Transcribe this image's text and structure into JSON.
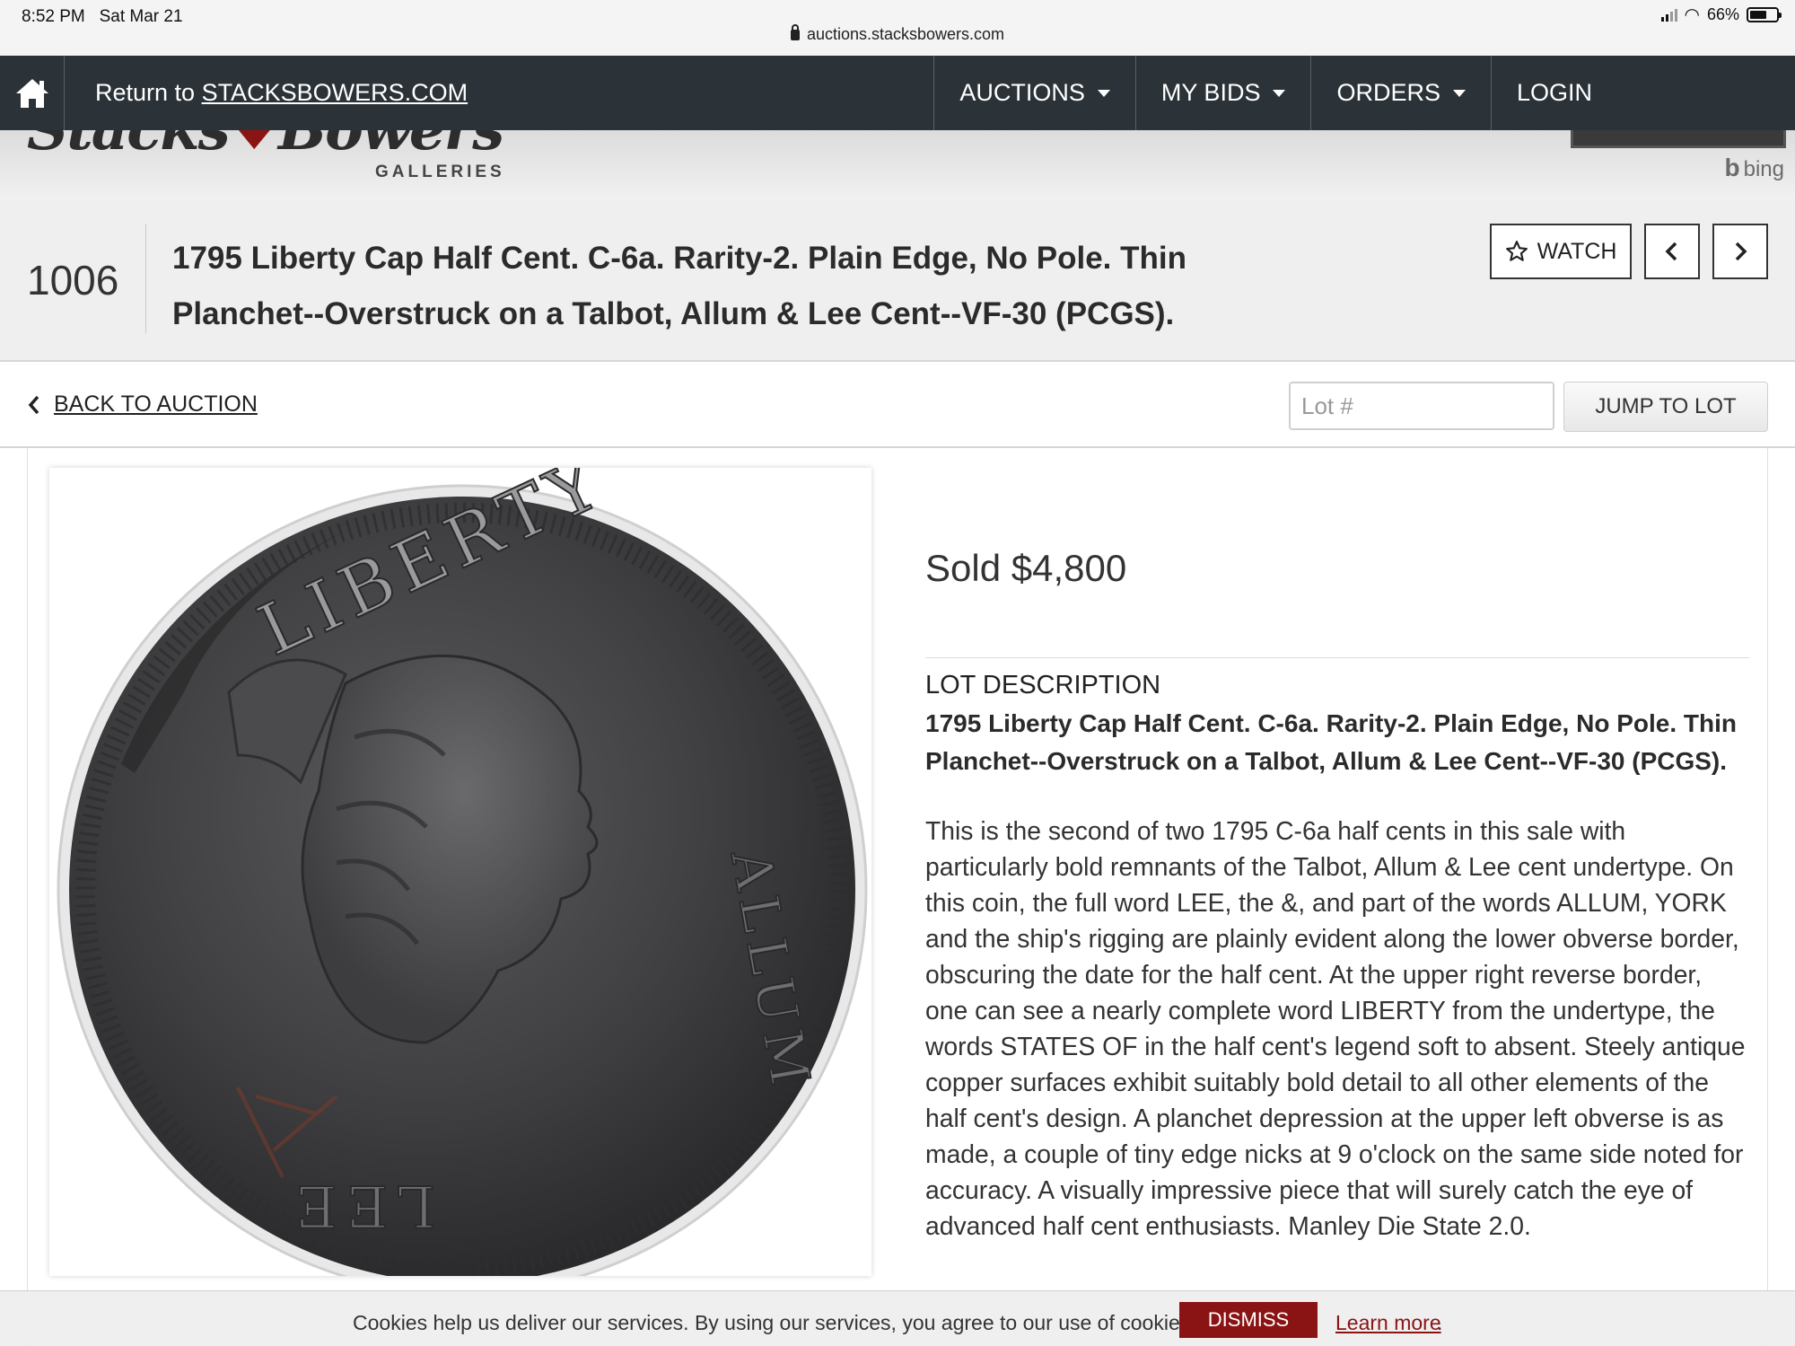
{
  "status_bar": {
    "time": "8:52 PM",
    "date": "Sat Mar 21",
    "url": "auctions.stacksbowers.com",
    "battery": "66%",
    "battery_level": 0.66
  },
  "topnav": {
    "return_prefix": "Return to ",
    "return_link": "STACKSBOWERS.COM",
    "items": [
      {
        "label": "AUCTIONS"
      },
      {
        "label": "MY BIDS"
      },
      {
        "label": "ORDERS"
      },
      {
        "label": "LOGIN"
      }
    ]
  },
  "logo": {
    "sub": "GALLERIES",
    "bing": "bing"
  },
  "lot": {
    "number": "1006",
    "title": "1795 Liberty Cap Half Cent. C-6a. Rarity-2. Plain Edge, No Pole. Thin Planchet--Overstruck on a Talbot, Allum & Lee Cent--VF-30 (PCGS).",
    "watch_label": "WATCH"
  },
  "back_bar": {
    "back_label": "BACK TO AUCTION",
    "lot_placeholder": "Lot #",
    "jump_label": "JUMP TO LOT"
  },
  "coin": {
    "legend_top": "LIBERTY",
    "undertype_right": "ALLUM",
    "undertype_bottom": "LEE"
  },
  "details": {
    "sold": "Sold $4,800",
    "description_label": "LOT DESCRIPTION",
    "description_title": "1795 Liberty Cap Half Cent. C-6a. Rarity-2. Plain Edge, No Pole. Thin Planchet--Overstruck on a Talbot, Allum & Lee Cent--VF-30 (PCGS).",
    "description_body": "This is the second of two 1795 C-6a half cents in this sale with particularly bold remnants of the Talbot, Allum & Lee cent undertype. On this coin, the full word LEE, the &, and part of the words ALLUM, YORK and the ship's rigging are plainly evident along the lower obverse border, obscuring the date for the half cent. At the upper right reverse border, one can see a nearly complete word LIBERTY from the undertype, the words STATES OF in the half cent's legend soft to absent. Steely antique copper surfaces exhibit suitably bold detail to all other elements of the half cent's design. A planchet depression at the upper left obverse is as made, a couple of tiny edge nicks at 9 o'clock on the same side noted for accuracy. A visually impressive piece that will surely catch the eye of advanced half cent enthusiasts. Manley Die State 2.0."
  },
  "cookie": {
    "text": "Cookies help us deliver our services. By using our services, you agree to our use of cookies.",
    "dismiss_label": "DISMISS",
    "learn_more": "Learn more"
  },
  "colors": {
    "nav_bg": "#2c3338",
    "dismiss_bg": "#8a1414",
    "coin_dark": "#3a3a3c"
  }
}
